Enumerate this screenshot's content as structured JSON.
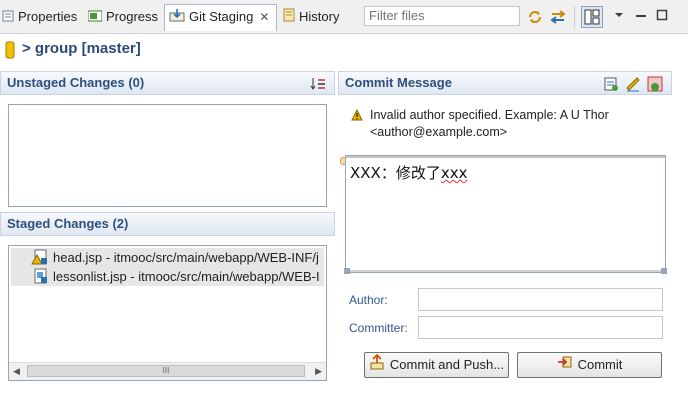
{
  "tabs": [
    {
      "label": "Properties",
      "icon": "properties-icon"
    },
    {
      "label": "Progress",
      "icon": "progress-icon"
    },
    {
      "label": "Git Staging",
      "icon": "git-staging-icon",
      "active": true
    },
    {
      "label": "History",
      "icon": "history-icon"
    }
  ],
  "filter": {
    "placeholder": "Filter files"
  },
  "repo": {
    "title": "> group [master]"
  },
  "unstaged": {
    "title": "Unstaged Changes (0)"
  },
  "staged": {
    "title": "Staged Changes (2)",
    "files": [
      {
        "label": "head.jsp - itmooc/src/main/webapp/WEB-INF/j"
      },
      {
        "label": "lessonlist.jsp - itmooc/src/main/webapp/WEB-I"
      }
    ],
    "scroll_thumb": "III"
  },
  "commit": {
    "title": "Commit Message",
    "warning": "Invalid author specified. Example: A U Thor <author@example.com>",
    "message_prefix": "XXX",
    "message_colon": "：",
    "message_body": "修改了",
    "message_suffix": "xxx",
    "author_label": "Author:",
    "committer_label": "Committer:",
    "author_value": "",
    "committer_value": "",
    "commit_push_label": "Commit and Push...",
    "commit_label": "Commit"
  },
  "colors": {
    "accent": "#2f4f7d",
    "tab_border": "#a9b8cc",
    "warning": "#e8b400"
  }
}
